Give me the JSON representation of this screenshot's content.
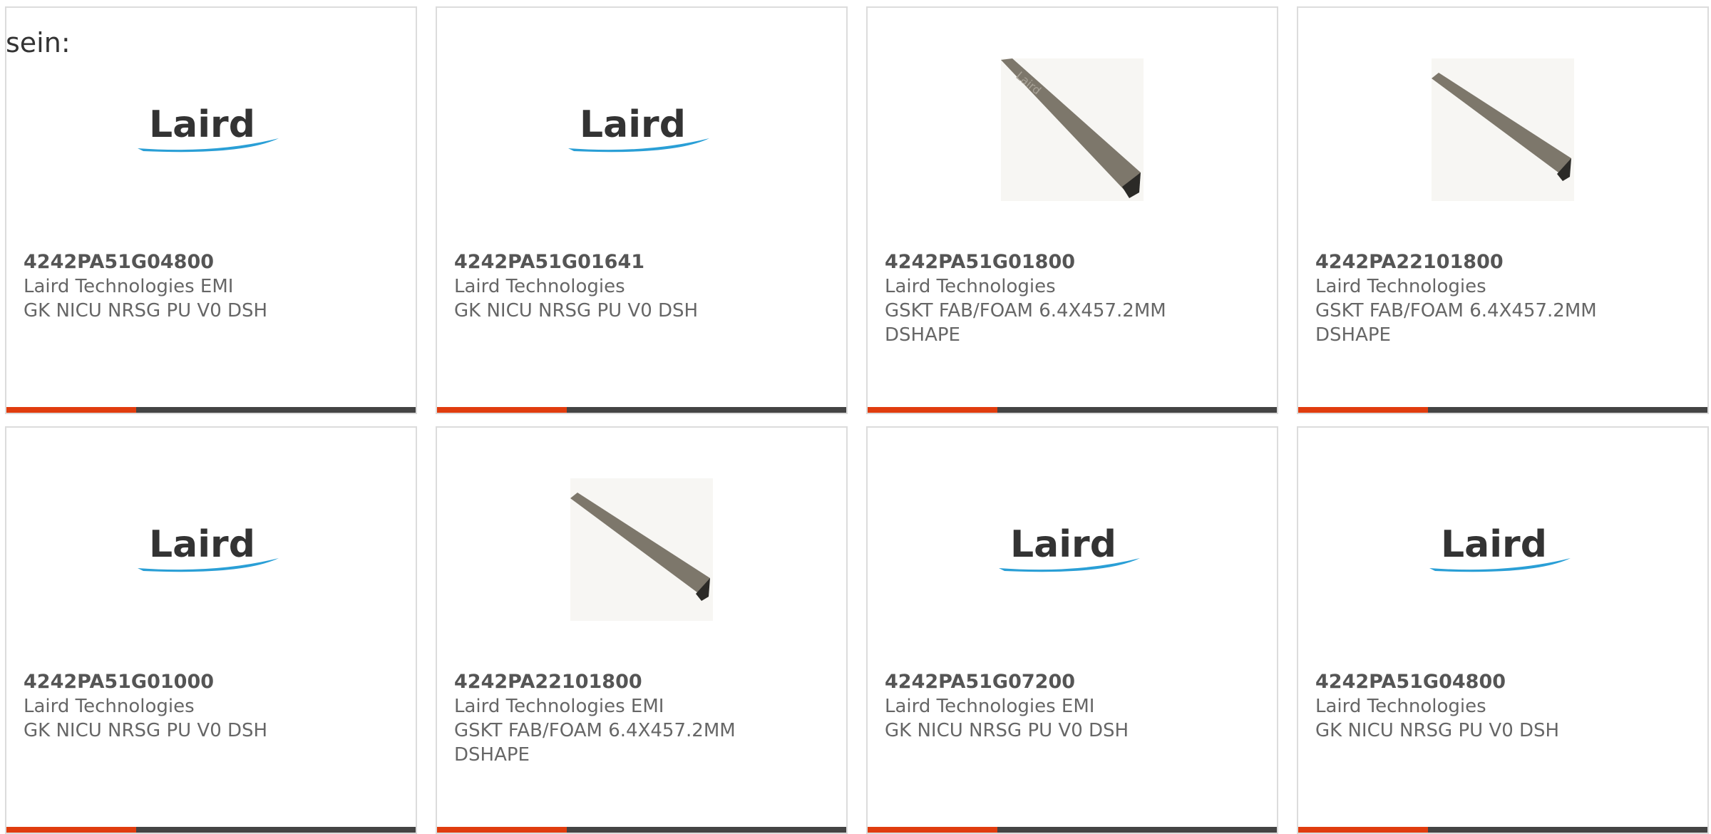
{
  "intro_text": "sein:",
  "accent_color": "#e03c0e",
  "products": [
    {
      "part": "4242PA51G04800",
      "manufacturer": "Laird Technologies EMI",
      "desc1": "GK NICU NRSG PU V0 DSH",
      "desc2": "",
      "image": "laird-logo",
      "logo_text": "Laird"
    },
    {
      "part": "4242PA51G01641",
      "manufacturer": "Laird Technologies",
      "desc1": "GK NICU NRSG PU V0 DSH",
      "desc2": "",
      "image": "laird-logo",
      "logo_text": "Laird"
    },
    {
      "part": "4242PA51G01800",
      "manufacturer": "Laird Technologies",
      "desc1": "GSKT FAB/FOAM 6.4X457.2MM",
      "desc2": "DSHAPE",
      "image": "gasket-photo",
      "logo_text": ""
    },
    {
      "part": "4242PA22101800",
      "manufacturer": "Laird Technologies",
      "desc1": "GSKT FAB/FOAM 6.4X457.2MM",
      "desc2": "DSHAPE",
      "image": "gasket-photo",
      "logo_text": ""
    },
    {
      "part": "4242PA51G01000",
      "manufacturer": "Laird Technologies",
      "desc1": "GK NICU NRSG PU V0 DSH",
      "desc2": "",
      "image": "laird-logo",
      "logo_text": "Laird"
    },
    {
      "part": "4242PA22101800",
      "manufacturer": "Laird Technologies EMI",
      "desc1": "GSKT FAB/FOAM 6.4X457.2MM",
      "desc2": "DSHAPE",
      "image": "gasket-photo",
      "logo_text": ""
    },
    {
      "part": "4242PA51G07200",
      "manufacturer": "Laird Technologies EMI",
      "desc1": "GK NICU NRSG PU V0 DSH",
      "desc2": "",
      "image": "laird-logo",
      "logo_text": "Laird"
    },
    {
      "part": "4242PA51G04800",
      "manufacturer": "Laird Technologies",
      "desc1": "GK NICU NRSG PU V0 DSH",
      "desc2": "",
      "image": "laird-logo",
      "logo_text": "Laird"
    }
  ]
}
